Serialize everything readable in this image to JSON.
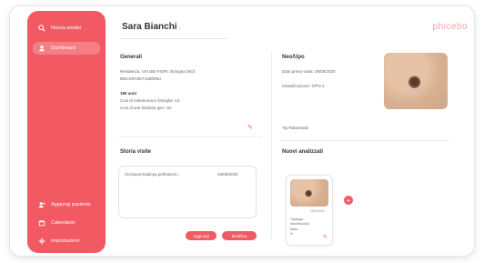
{
  "sidebar": {
    "items": [
      {
        "label": "Nuova analisi",
        "icon": "search-icon"
      },
      {
        "label": "Dashboard",
        "icon": "user-icon"
      },
      {
        "label": "Aggiungi paziente",
        "icon": "add-user-icon"
      },
      {
        "label": "Calendario",
        "icon": "calendar-icon"
      },
      {
        "label": "Impostazioni",
        "icon": "gear-icon"
      }
    ]
  },
  "header": {
    "patient_name": "Sara Bianchi",
    "brand": "phicebo",
    "caret": "›"
  },
  "general": {
    "title": "Generali",
    "line1": "Residenza: VIA DEI FIORI, Bologna (BO)",
    "line2": "BNCSRA85T41B009U",
    "line3": "190 anni",
    "line4": "Cosi di melanoma in famiglia: AC",
    "line5": "Cosi di anti-familiari gen: AD"
  },
  "neo": {
    "title": "Neo/Upo",
    "line1": "Data prima visita: 28/05/2020",
    "line2": "Classificazione: TIPO 2",
    "footer": "Tip Rabinowitz"
  },
  "history": {
    "title": "Storia visite",
    "entry_text": "Ciclosporinaaloya.pelmasurs...",
    "entry_date": "28/05/2020",
    "btn1": "Aggiungi",
    "btn2": "Modifica"
  },
  "analyses": {
    "title": "Nuovi analizzati",
    "card_date": "28/05/2020",
    "card_line1": "Tipologia:",
    "card_line2": "Neo/Nevo/Ulc",
    "card_line3": "Stato:",
    "card_line4": "N"
  },
  "colors": {
    "accent": "#f25a63",
    "brand": "#f5a2a8"
  }
}
